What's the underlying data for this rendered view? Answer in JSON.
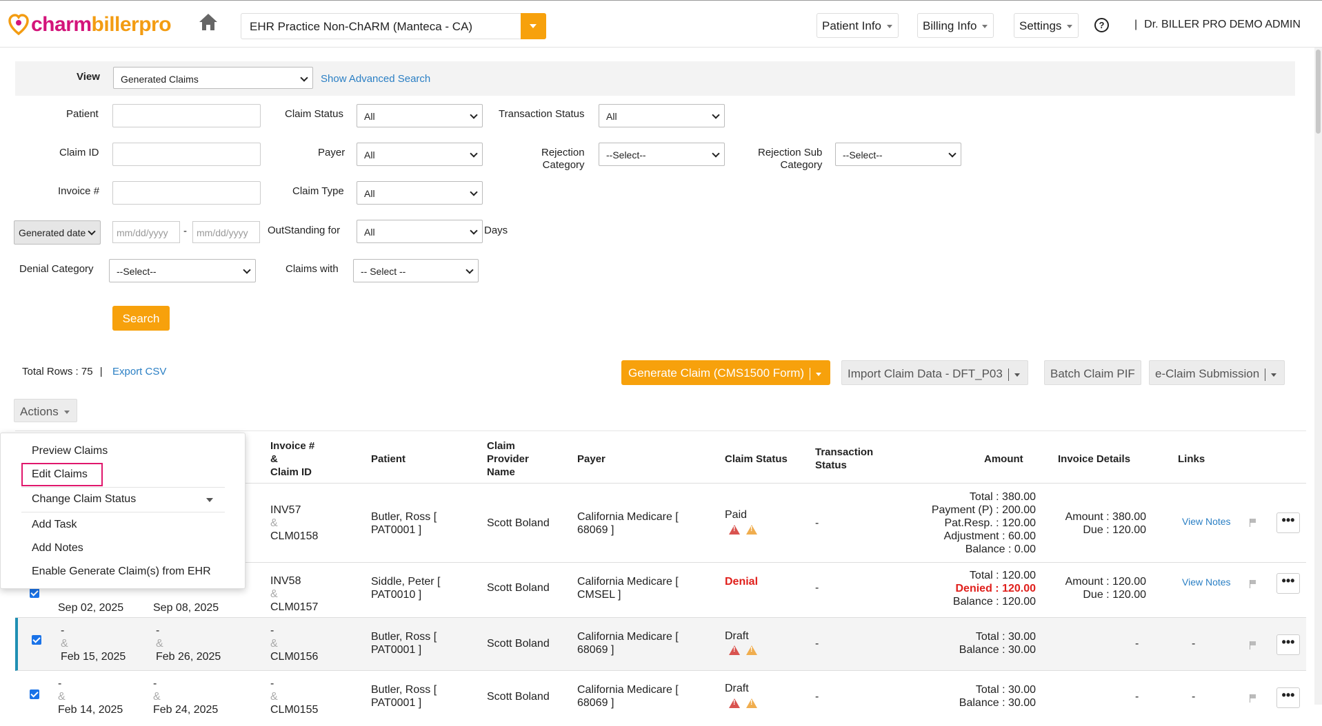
{
  "header": {
    "logo_part1": "charm",
    "logo_part2": "billerpro",
    "practice": "EHR Practice Non-ChARM (Manteca - CA)",
    "nav": [
      "Patient Info",
      "Billing Info",
      "Settings"
    ],
    "help_glyph": "?",
    "user": "Dr. BILLER PRO DEMO ADMIN",
    "user_sep": "|"
  },
  "filters": {
    "view_label": "View",
    "view_value": "Generated Claims",
    "advanced_link": "Show Advanced Search",
    "patient_label": "Patient",
    "claim_id_label": "Claim ID",
    "invoice_label": "Invoice #",
    "claim_status_label": "Claim Status",
    "claim_status_value": "All",
    "payer_label": "Payer",
    "payer_value": "All",
    "claim_type_label": "Claim Type",
    "claim_type_value": "All",
    "transaction_status_label": "Transaction Status",
    "transaction_status_value": "All",
    "rejection_category_label_1": "Rejection",
    "rejection_category_label_2": "Category",
    "rejection_category_value": "--Select--",
    "rejection_sub_label_1": "Rejection Sub",
    "rejection_sub_label_2": "Category",
    "rejection_sub_value": "--Select--",
    "date_type_value": "Generated date",
    "date_from_placeholder": "mm/dd/yyyy",
    "date_to_placeholder": "mm/dd/yyyy",
    "date_sep": "-",
    "outstanding_label": "OutStanding for",
    "outstanding_value": "All",
    "days_label": "Days",
    "denial_category_label": "Denial Category",
    "denial_category_value": "--Select--",
    "claims_with_label": "Claims with",
    "claims_with_value": "-- Select --",
    "search_button": "Search"
  },
  "toolbar": {
    "total_rows": "Total Rows : 75",
    "sep": "|",
    "export_csv": "Export CSV",
    "generate_claim": "Generate Claim (CMS1500 Form)",
    "import_claim": "Import Claim Data - DFT_P03",
    "batch_claim": "Batch Claim PIF",
    "eclaim": "e-Claim Submission",
    "actions": "Actions"
  },
  "actions_menu": {
    "items": [
      "Preview Claims",
      "Edit Claims",
      "Change Claim Status",
      "Add Task",
      "Add Notes",
      "Enable Generate Claim(s) from EHR"
    ]
  },
  "table": {
    "headers": {
      "invoice_1": "Invoice #",
      "invoice_2": "&",
      "invoice_3": "Claim ID",
      "patient": "Patient",
      "provider_1": "Claim",
      "provider_2": "Provider",
      "provider_3": "Name",
      "payer": "Payer",
      "claim_status": "Claim Status",
      "transaction_1": "Transaction",
      "transaction_2": "Status",
      "amount": "Amount",
      "invoice_details": "Invoice Details",
      "links": "Links"
    },
    "rows": [
      {
        "invoice": "INV57",
        "amp": "&",
        "claim_id": "CLM0158",
        "patient_1": "Butler, Ross [",
        "patient_2": "PAT0001 ]",
        "provider": "Scott Boland",
        "payer_1": "California Medicare [",
        "payer_2": "68069 ]",
        "status": "Paid",
        "transaction": "-",
        "amount_lines": [
          "Total : 380.00",
          "Payment (P) : 200.00",
          "Pat.Resp. : 120.00",
          "Adjustment : 60.00",
          "Balance : 0.00"
        ],
        "invoice_lines": [
          "Amount : 380.00",
          "Due : 120.00"
        ],
        "link": "View Notes",
        "menu": "•••"
      },
      {
        "date1": "Sep 02, 2025",
        "date2": "Sep 08, 2025",
        "invoice": "INV58",
        "amp": "&",
        "claim_id": "CLM0157",
        "patient_1": "Siddle, Peter [",
        "patient_2": "PAT0010 ]",
        "provider": "Scott Boland",
        "payer_1": "California Medicare [",
        "payer_2": "CMSEL ]",
        "status": "Denial",
        "transaction": "-",
        "amount_lines": [
          "Total : 120.00",
          "Denied : 120.00",
          "Balance : 120.00"
        ],
        "invoice_lines": [
          "Amount : 120.00",
          "Due : 120.00"
        ],
        "link": "View Notes",
        "menu": "•••"
      },
      {
        "d1_top": "-",
        "d2_top": "-",
        "amp": "&",
        "date1": "Feb 15, 2025",
        "date2": "Feb 26, 2025",
        "invoice": "-",
        "claim_id": "CLM0156",
        "patient_1": "Butler, Ross [",
        "patient_2": "PAT0001 ]",
        "provider": "Scott Boland",
        "payer_1": "California Medicare [",
        "payer_2": "68069 ]",
        "status": "Draft",
        "transaction": "-",
        "amount_lines": [
          "Total : 30.00",
          "Balance : 30.00"
        ],
        "invoice_details": "-",
        "links": "-",
        "menu": "•••"
      },
      {
        "d1_top": "-",
        "d2_top": "-",
        "amp": "&",
        "date1": "Feb 14, 2025",
        "date2": "Feb 24, 2025",
        "invoice": "-",
        "claim_id": "CLM0155",
        "patient_1": "Butler, Ross [",
        "patient_2": "PAT0001 ]",
        "provider": "Scott Boland",
        "payer_1": "California Medicare [",
        "payer_2": "68069 ]",
        "status": "Draft",
        "transaction": "-",
        "amount_lines": [
          "Total : 30.00",
          "Balance : 30.00"
        ],
        "invoice_details": "-",
        "links": "-",
        "menu": "•••"
      }
    ]
  },
  "colors": {
    "accent": "#f7a10c",
    "brand_pink": "#d3147a",
    "link": "#2a7fc4",
    "denial": "#e0201c",
    "highlight_row_border": "#1f8fb3"
  }
}
